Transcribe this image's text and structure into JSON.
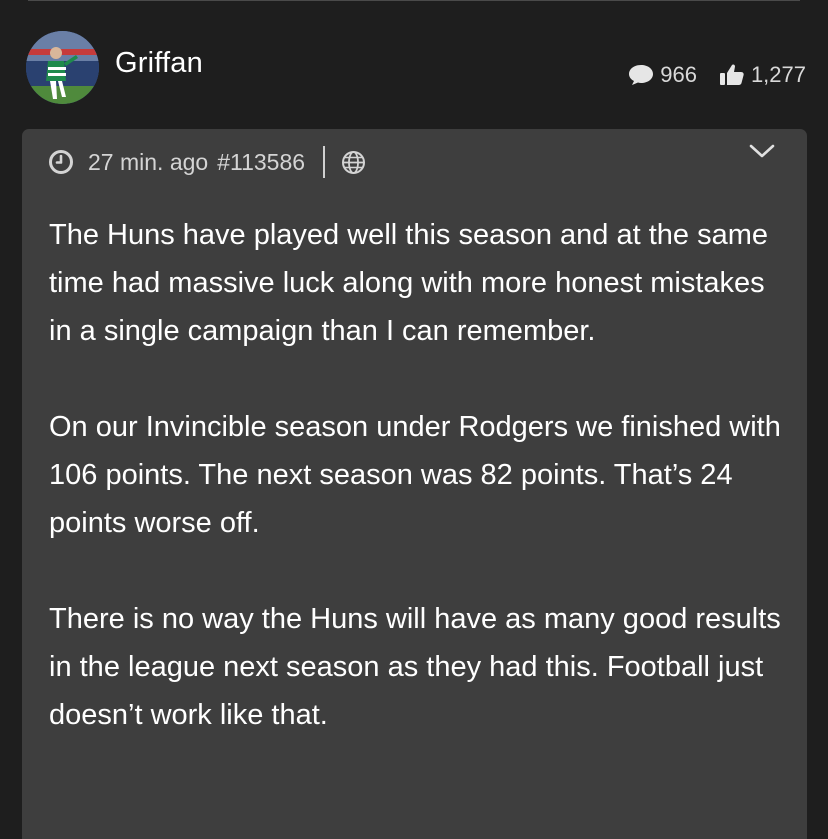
{
  "user": {
    "name": "Griffan",
    "avatar_icon": "footballer-photo-avatar",
    "comments_icon": "speech-bubble-icon",
    "comments_count": "966",
    "likes_icon": "thumbs-up-icon",
    "likes_count": "1,277"
  },
  "post": {
    "time_ago": "27 min. ago",
    "post_id": "#113586",
    "visibility_icon": "globe-icon",
    "menu_icon": "chevron-down-icon",
    "paragraphs": [
      "The Huns have played well this season and at the same time had massive luck along with more honest mistakes in a single campaign than I can remember.",
      "On our Invincible season under Rodgers we finished with 106 points. The next season was 82 points. That’s 24 points worse off.",
      "There is no way the Huns will have as many good results in the league next season as they had this. Football just doesn’t work like that."
    ]
  },
  "colors": {
    "background": "#1e1e1e",
    "card": "#3e3e3e",
    "text": "#ffffff",
    "muted": "#d4d4d4"
  }
}
